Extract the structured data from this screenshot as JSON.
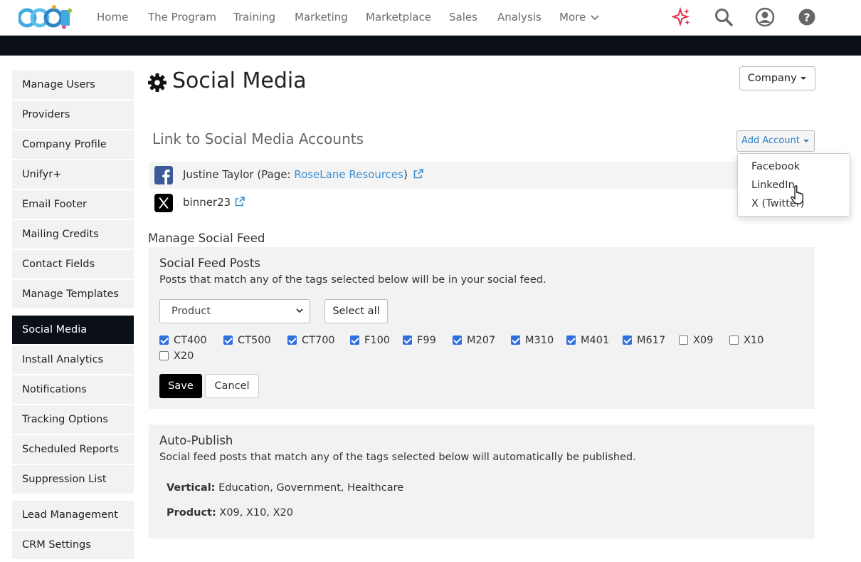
{
  "colors": {
    "accent_link": "#3b8fd0",
    "dark": "#0b0f18",
    "checkbox": "#2f6fe0"
  },
  "topnav": {
    "logo_text": "CCOE",
    "items": [
      "Home",
      "The Program",
      "Training",
      "Marketing",
      "Marketplace",
      "Sales",
      "Analysis",
      "More"
    ],
    "icons": [
      "sparkle-icon",
      "search-icon",
      "user-icon",
      "help-icon"
    ]
  },
  "sidebar": {
    "items": [
      {
        "label": "Manage Users"
      },
      {
        "label": "Providers"
      },
      {
        "label": "Company Profile"
      },
      {
        "label": "Unifyr+"
      },
      {
        "label": "Email Footer"
      },
      {
        "label": "Mailing Credits"
      },
      {
        "label": "Contact Fields"
      },
      {
        "label": "Manage Templates"
      },
      {
        "label": "Social Media"
      },
      {
        "label": "Install Analytics"
      },
      {
        "label": "Notifications"
      },
      {
        "label": "Tracking Options"
      },
      {
        "label": "Scheduled Reports"
      },
      {
        "label": "Suppression List"
      },
      {
        "label": "Lead Management"
      },
      {
        "label": "CRM Settings"
      }
    ],
    "active_index": 8
  },
  "header": {
    "title": "Social Media",
    "company_button": "Company"
  },
  "accounts": {
    "section_title": "Link to Social Media Accounts",
    "add_button": "Add Account",
    "rows": [
      {
        "icon": "facebook-icon",
        "name_prefix": "Justine Taylor (Page: ",
        "page_link": "RoseLane Resources",
        "name_suffix": ")"
      },
      {
        "icon": "x-twitter-icon",
        "name_prefix": "binner23"
      }
    ],
    "dropdown": [
      "Facebook",
      "LinkedIn",
      "X (Twitter)"
    ]
  },
  "social_feed": {
    "section_title": "Manage Social Feed",
    "panel_title": "Social Feed Posts",
    "description": "Posts that match any of the tags selected below will be in your social feed.",
    "select_value": "Product",
    "select_all": "Select all",
    "tags": [
      {
        "label": "CT400",
        "checked": true
      },
      {
        "label": "CT500",
        "checked": true
      },
      {
        "label": "CT700",
        "checked": true
      },
      {
        "label": "F100",
        "checked": true
      },
      {
        "label": "F99",
        "checked": true
      },
      {
        "label": "M207",
        "checked": true
      },
      {
        "label": "M310",
        "checked": true
      },
      {
        "label": "M401",
        "checked": true
      },
      {
        "label": "M617",
        "checked": true
      },
      {
        "label": "X09",
        "checked": false
      },
      {
        "label": "X10",
        "checked": false
      },
      {
        "label": "X20",
        "checked": false
      }
    ],
    "save": "Save",
    "cancel": "Cancel"
  },
  "auto_publish": {
    "title": "Auto-Publish",
    "description": "Social feed posts that match any of the tags selected below will automatically be published.",
    "vertical_label": "Vertical:",
    "vertical_value": "Education, Government, Healthcare",
    "product_label": "Product:",
    "product_value": "X09, X10, X20"
  }
}
